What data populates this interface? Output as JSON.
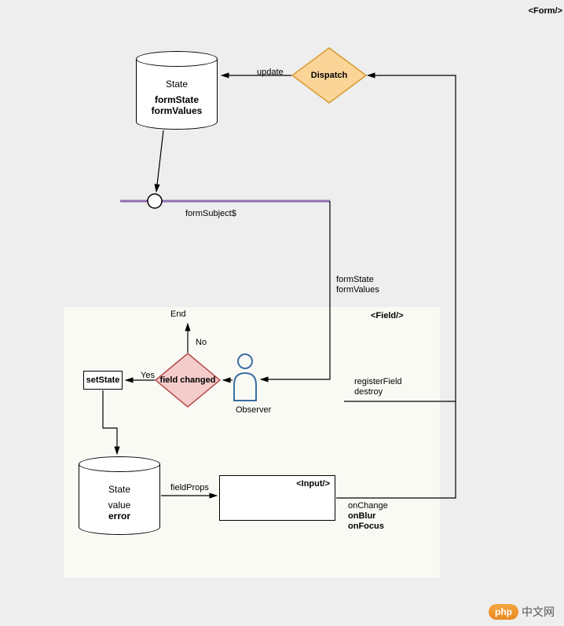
{
  "topRight": "<Form/>",
  "formState": {
    "title": "State",
    "l1": "formState",
    "l2": "formValues"
  },
  "dispatch": "Dispatch",
  "updateLabel": "update",
  "subjectLabel": "formSubject$",
  "subjectPayload": {
    "l1": "formState",
    "l2": "formValues"
  },
  "fieldTag": "<Field/>",
  "observer": "Observer",
  "decision": "field changed",
  "yes": "Yes",
  "no": "No",
  "end": "End",
  "setState": "setState",
  "fieldState": {
    "title": "State",
    "l1": "value",
    "l2": "error"
  },
  "fieldProps": "fieldProps",
  "inputTag": "<Input/>",
  "inputHandlers": {
    "l1": "onChange",
    "l2": "onBlur",
    "l3": "onFocus"
  },
  "fieldActions": {
    "l1": "registerField",
    "l2": "destroy"
  },
  "watermark": {
    "badge": "php",
    "text": "中文网"
  }
}
